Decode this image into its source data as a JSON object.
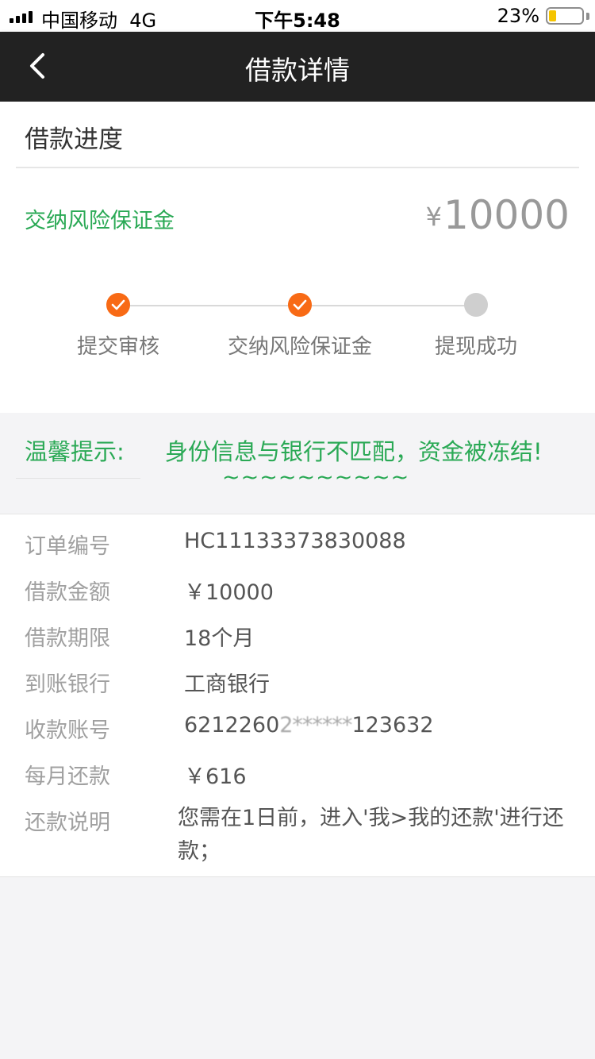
{
  "status_bar": {
    "carrier": "中国移动",
    "network": "4G",
    "time": "下午5:48",
    "battery": "23%",
    "battery_level": 0.23
  },
  "nav": {
    "title": "借款详情",
    "back_icon": "chevron-left-icon"
  },
  "progress": {
    "section_title": "借款进度",
    "status_label": "交纳风险保证金",
    "currency": "¥",
    "amount": "10000",
    "steps": [
      {
        "label": "提交审核",
        "state": "done"
      },
      {
        "label": "交纳风险保证金",
        "state": "done"
      },
      {
        "label": "提现成功",
        "state": "pending"
      }
    ]
  },
  "tip": {
    "title": "温馨提示:",
    "message": "身份信息与银行不匹配，资金被冻结!",
    "tilde": "~~~~~~~~~~"
  },
  "details": [
    {
      "label": "订单编号",
      "value": "HC11133373830088"
    },
    {
      "label": "借款金额",
      "value": "￥10000"
    },
    {
      "label": "借款期限",
      "value": "18个月"
    },
    {
      "label": "到账银行",
      "value": "工商银行"
    },
    {
      "label": "收款账号",
      "value_prefix": "6212260",
      "value_masked": "2******",
      "value_suffix": "123632"
    },
    {
      "label": "每月还款",
      "value": "￥616"
    },
    {
      "label": "还款说明",
      "value": "您需在1日前，进入'我>我的还款'进行还款；"
    }
  ],
  "colors": {
    "accent_green": "#2aa955",
    "step_done": "#f86a15",
    "step_pending": "#cfcfcf",
    "navbar": "#222222"
  }
}
